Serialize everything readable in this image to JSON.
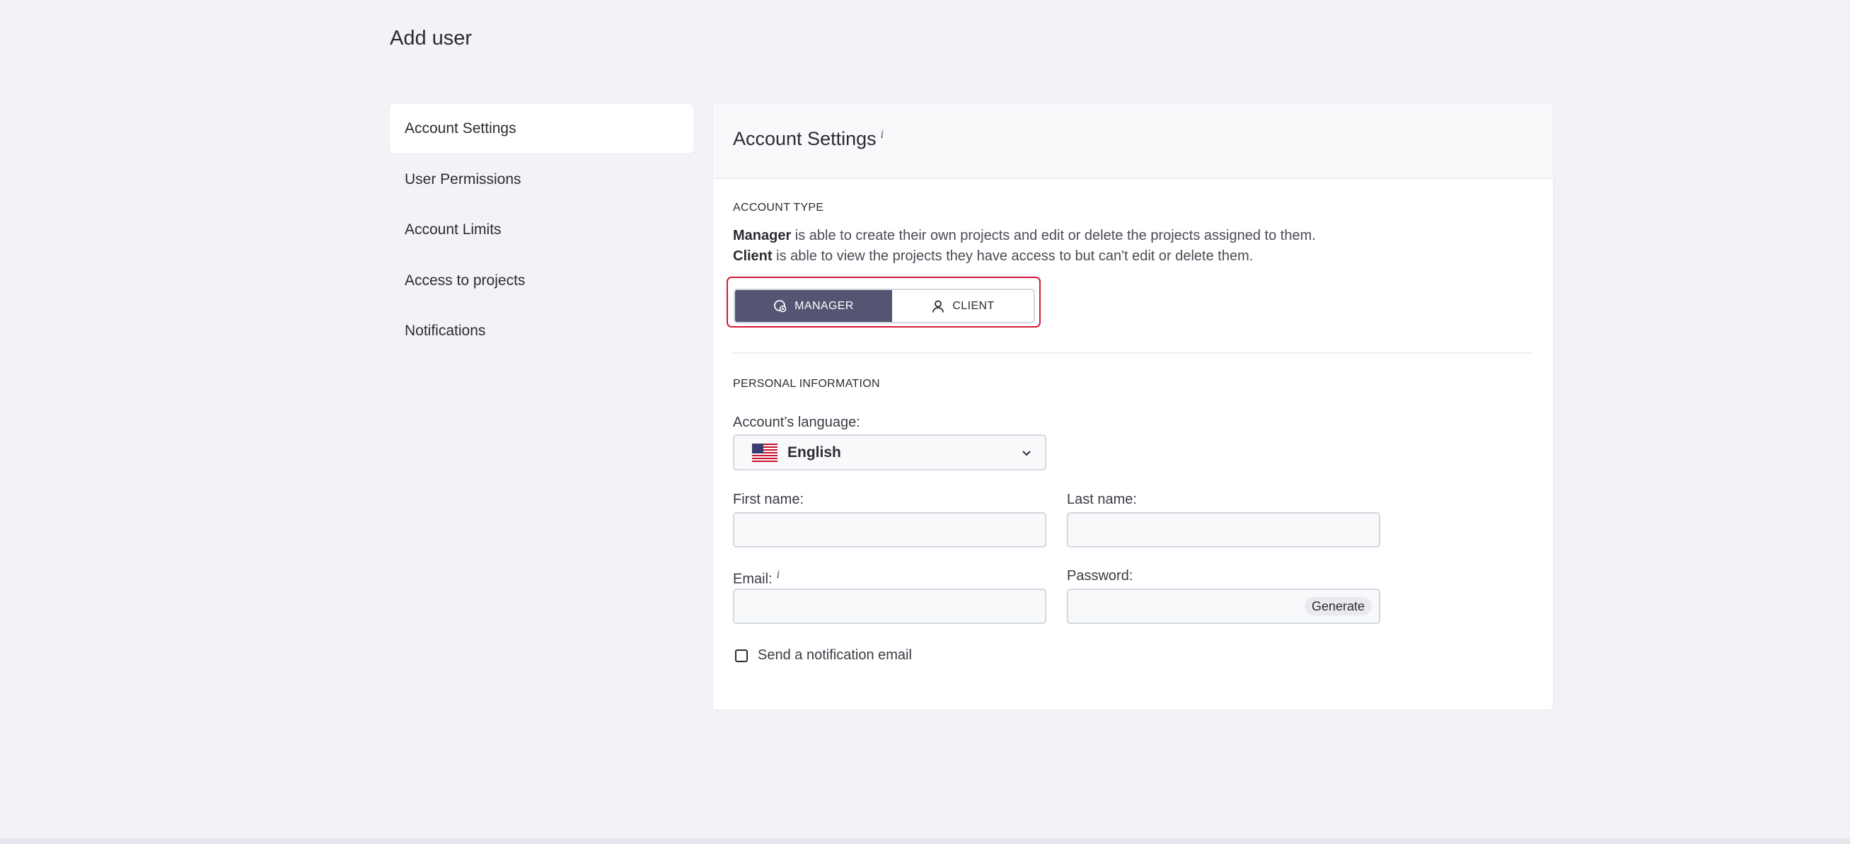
{
  "page": {
    "title": "Add user"
  },
  "sidebar": {
    "items": [
      {
        "label": "Account Settings",
        "active": true
      },
      {
        "label": "User Permissions",
        "active": false
      },
      {
        "label": "Account Limits",
        "active": false
      },
      {
        "label": "Access to projects",
        "active": false
      },
      {
        "label": "Notifications",
        "active": false
      }
    ]
  },
  "panel": {
    "title": "Account Settings",
    "info_icon": "i",
    "account_type": {
      "section_label": "ACCOUNT TYPE",
      "manager_term": "Manager",
      "manager_desc": " is able to create their own projects and edit or delete the projects assigned to them.",
      "client_term": "Client",
      "client_desc": " is able to view the projects they have access to but can't edit or delete them.",
      "options": [
        {
          "label": "MANAGER",
          "icon": "manager-icon",
          "selected": true
        },
        {
          "label": "CLIENT",
          "icon": "user-icon",
          "selected": false
        }
      ],
      "selected_color": "#565473",
      "highlight_color": "#d6193c"
    },
    "personal_info": {
      "section_label": "PERSONAL INFORMATION",
      "language_label": "Account’s language:",
      "language_value": "English",
      "language_flag": "us-flag-icon",
      "first_name_label": "First name:",
      "first_name_value": "",
      "last_name_label": "Last name:",
      "last_name_value": "",
      "email_label": "Email:",
      "email_info": "i",
      "email_value": "",
      "password_label": "Password:",
      "password_value": "",
      "generate_label": "Generate",
      "notify_label": "Send a notification email",
      "notify_checked": false
    }
  }
}
